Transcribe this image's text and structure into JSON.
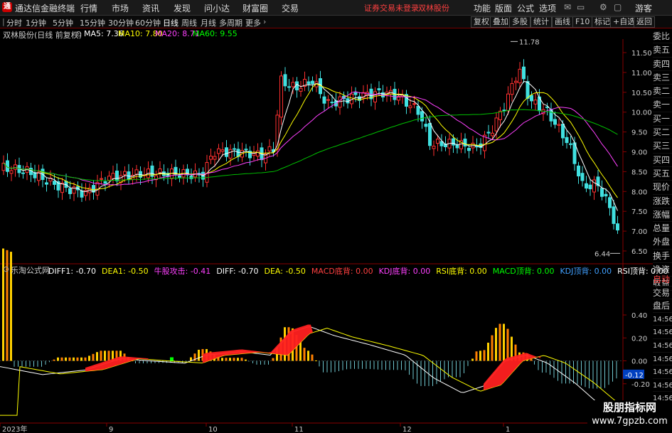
{
  "titlebar": {
    "app_name": "通达信金融终端",
    "menus": [
      "行情",
      "市场",
      "资讯",
      "发现",
      "问小达",
      "财富圈",
      "交易"
    ],
    "warning": "证券交易未登录",
    "stock": "双林股份",
    "right_menus": [
      "功能",
      "版面",
      "公式",
      "选项"
    ],
    "user": "游客"
  },
  "periods": [
    "分时",
    "1分钟",
    "5分钟",
    "15分钟",
    "30分钟",
    "60分钟",
    "日线",
    "周线",
    "月线",
    "多周期",
    "更多"
  ],
  "active_period": "日线",
  "toolbar_right": [
    "复权",
    "叠加",
    "多股",
    "统计",
    "画线",
    "F10",
    "标记",
    "+自选",
    "返回"
  ],
  "main_header": {
    "title": "双林股份(日线 前复权)",
    "ma": [
      {
        "label": "MA5: 7.36",
        "color": "#ffffff"
      },
      {
        "label": "MA10: 7.80",
        "color": "#ffff00"
      },
      {
        "label": "MA20: 8.71",
        "color": "#ff40ff"
      },
      {
        "label": "MA60: 9.55",
        "color": "#00ff00"
      }
    ]
  },
  "sub_header": {
    "title": "乐淘公式网",
    "items": [
      {
        "label": "DIFF1: -0.70",
        "color": "#ffffff"
      },
      {
        "label": "DEA1: -0.50",
        "color": "#ffff00"
      },
      {
        "label": "牛股攻击: -0.41",
        "color": "#ff40ff"
      },
      {
        "label": "DIFF: -0.70",
        "color": "#ffffff"
      },
      {
        "label": "DEA: -0.50",
        "color": "#ffff00"
      },
      {
        "label": "MACD底背: 0.00",
        "color": "#ff4040"
      },
      {
        "label": "KDJ底背: 0.00",
        "color": "#ff40ff"
      },
      {
        "label": "RSI底背: 0.00",
        "color": "#ffff00"
      },
      {
        "label": "MACD顶背: 0.00",
        "color": "#00ff00"
      },
      {
        "label": "KDJ顶背: 0.00",
        "color": "#40a0ff"
      },
      {
        "label": "RSI顶背: 0.00",
        "color": "#ffffff"
      }
    ]
  },
  "side_labels": [
    "委比",
    "卖五",
    "卖四",
    "卖三",
    "卖二",
    "卖一",
    "买一",
    "买二",
    "买三",
    "买四",
    "买五",
    "现价",
    "涨跌",
    "涨幅",
    "总量",
    "外盘",
    "换手",
    "净资",
    "收益"
  ],
  "side_labels_lower": [
    "自动",
    "交易",
    "盘后",
    "14:56",
    "14:56",
    "14:56",
    "14:56",
    "14:56",
    "14:56",
    "14:56",
    "14:56"
  ],
  "price_axis": [
    "11.50",
    "11.00",
    "10.50",
    "10.00",
    "9.50",
    "9.00",
    "8.50",
    "8.00",
    "7.50",
    "7.00",
    "6.50"
  ],
  "macd_axis": [
    "0.40",
    "0.20",
    "0.00",
    "-0.20",
    "-0.40"
  ],
  "macd_current": "-0.12",
  "high_label": "11.78",
  "low_label": "6.44",
  "time_axis": [
    "2023年",
    "9",
    "10",
    "11",
    "12",
    "1"
  ],
  "watermark": {
    "line1": "股朋指标网",
    "line2": "www.7gpzb.com"
  },
  "colors": {
    "up": "#ff3030",
    "down": "#40e0e0",
    "ma5": "#ffffff",
    "ma10": "#ffff00",
    "ma20": "#ff40ff",
    "ma60": "#00c000"
  }
}
